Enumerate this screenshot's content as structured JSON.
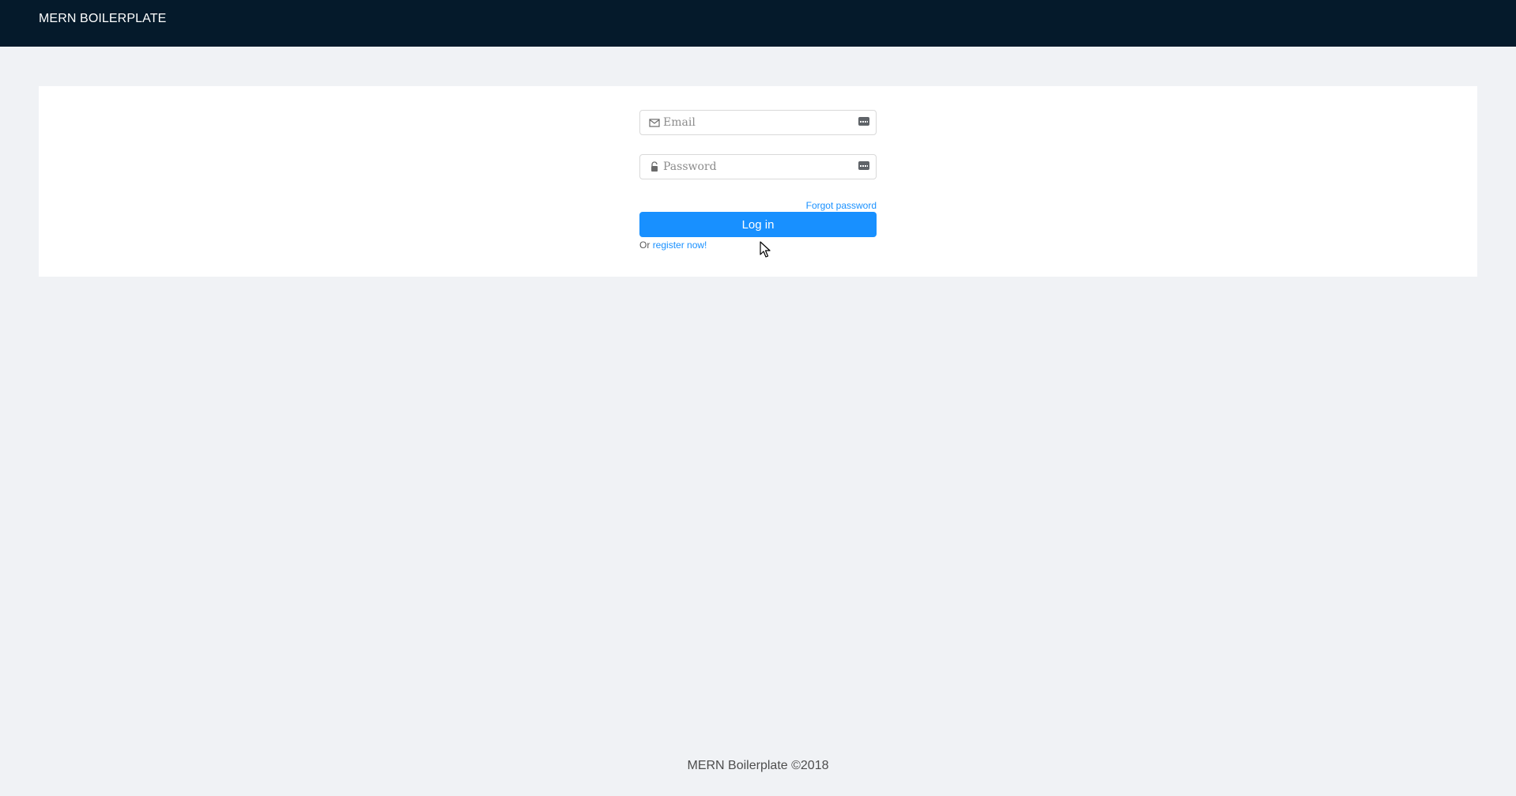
{
  "header": {
    "brand": "MERN BOILERPLATE"
  },
  "login_form": {
    "email": {
      "placeholder": "Email",
      "value": "",
      "prefix_icon": "mail-icon",
      "suffix_icon": "autofill-key-icon"
    },
    "password": {
      "placeholder": "Password",
      "value": "",
      "prefix_icon": "lock-icon",
      "suffix_icon": "autofill-key-icon"
    },
    "forgot_password": "Forgot password",
    "submit_label": "Log in",
    "register_prefix": "Or",
    "register_link": "register now!"
  },
  "footer": {
    "text": "MERN Boilerplate ©2018"
  },
  "colors": {
    "header_bg": "#051a2b",
    "page_bg": "#f0f2f5",
    "accent": "#1890ff"
  }
}
